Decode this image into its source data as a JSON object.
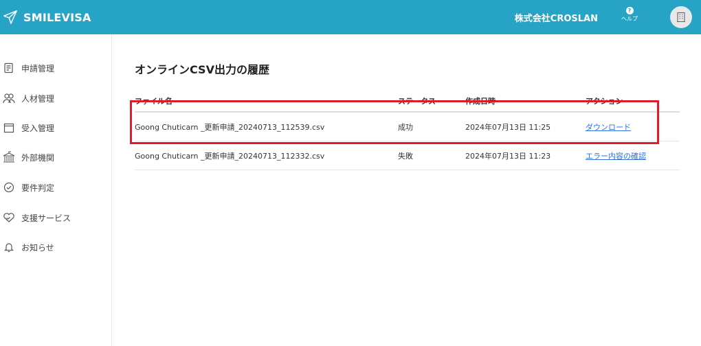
{
  "header": {
    "brand": "SMILEVISA",
    "company": "株式会社CROSLAN",
    "help_label": "ヘルプ",
    "help_glyph": "?"
  },
  "sidebar": {
    "items": [
      {
        "label": "申請管理",
        "icon": "document-icon"
      },
      {
        "label": "人材管理",
        "icon": "people-icon"
      },
      {
        "label": "受入管理",
        "icon": "calendar-icon"
      },
      {
        "label": "外部機関",
        "icon": "building-icon"
      },
      {
        "label": "要件判定",
        "icon": "check-circle-icon"
      },
      {
        "label": "支援サービス",
        "icon": "handshake-icon"
      },
      {
        "label": "お知らせ",
        "icon": "bell-icon"
      }
    ]
  },
  "main": {
    "title": "オンラインCSV出力の履歴",
    "columns": [
      "ファイル名",
      "ステータス",
      "作成日時",
      "アクション"
    ],
    "rows": [
      {
        "filename": "Goong Chuticarn _更新申請_20240713_112539.csv",
        "status": "成功",
        "created": "2024年07月13日 11:25",
        "action": "ダウンロード"
      },
      {
        "filename": "Goong Chuticarn _更新申請_20240713_112332.csv",
        "status": "失敗",
        "created": "2024年07月13日 11:23",
        "action": "エラー内容の確認"
      }
    ]
  },
  "colors": {
    "header_bg": "#27a4c5",
    "link": "#2f6fe0",
    "highlight": "#e11a2b"
  }
}
